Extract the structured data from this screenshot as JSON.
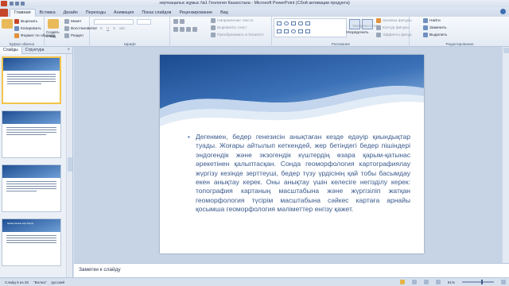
{
  "window": {
    "title": "эерткаңалыс жұмыс №1 Геология Казахстана  -  Microsoft PowerPoint (Сбой активации продукта)"
  },
  "ribbon_tabs": [
    "Главная",
    "Вставка",
    "Дизайн",
    "Переходы",
    "Анимация",
    "Показ слайдов",
    "Рецензирование",
    "Вид"
  ],
  "ribbon": {
    "clipboard": {
      "cut": "Вырезать",
      "copy": "Копировать",
      "format_painter": "Формат по образцу",
      "label": "Буфер обмена"
    },
    "slides": {
      "create": "Создать слайд",
      "layout": "Макет",
      "reset": "Восстановить",
      "section": "Раздел"
    },
    "font": {
      "label": "Шрифт"
    },
    "paragraph": {
      "direction": "Направление текста",
      "align": "Выровнять текст",
      "smartart": "Преобразовать в SmartArt"
    },
    "drawing": {
      "arrange": "Упорядочить",
      "quick_styles": "Экспресс-стили",
      "fill": "Заливка фигуры",
      "outline": "Контур фигуры",
      "effects": "Эффекты фигур",
      "label": "Рисование"
    },
    "editing": {
      "find": "Найти",
      "replace": "Заменить",
      "select": "Выделить",
      "label": "Редактирование"
    }
  },
  "left_panel": {
    "tabs": [
      "Слайды",
      "Структура"
    ],
    "slide_numbers": [
      "4",
      "5",
      "6",
      "7"
    ],
    "thumb_title_7": "Қазақстанның жер бедері"
  },
  "slide": {
    "body": "Дегенмен, бедер генезисін анықтаған кезде едәуір қиындықтар туады. Жоғары айтылып кеткендей, жер бетіндегі бедер пішіндері эндогендік және экзогендік күштердің өзара қарым-қатынас әрекетінен қалыптасқан. Сонда геоморфология картографиялау жүргізу кезінде зерттеуші, бедер түзу үрдісінің қай тобы басымдау екен анықтау керек. Оны анықтау үшін келесіге негізділу керек: топография картаның масштабына және жүргізіліп жатқан геоморфология түсірім масштабына сәйкес картаға арнайы қосымша геоморфология мәліметтер енгізу қажет."
  },
  "notes": {
    "placeholder": "Заметки к слайду"
  },
  "status": {
    "slide_of": "Слайд 5 из 26",
    "theme": "\"Волна\"",
    "language": "русский",
    "zoom": "61%"
  },
  "colors": {
    "accent": "#3a6cb0",
    "slide_text": "#3a5a8c",
    "ribbon_bg": "#e3eaf4"
  }
}
